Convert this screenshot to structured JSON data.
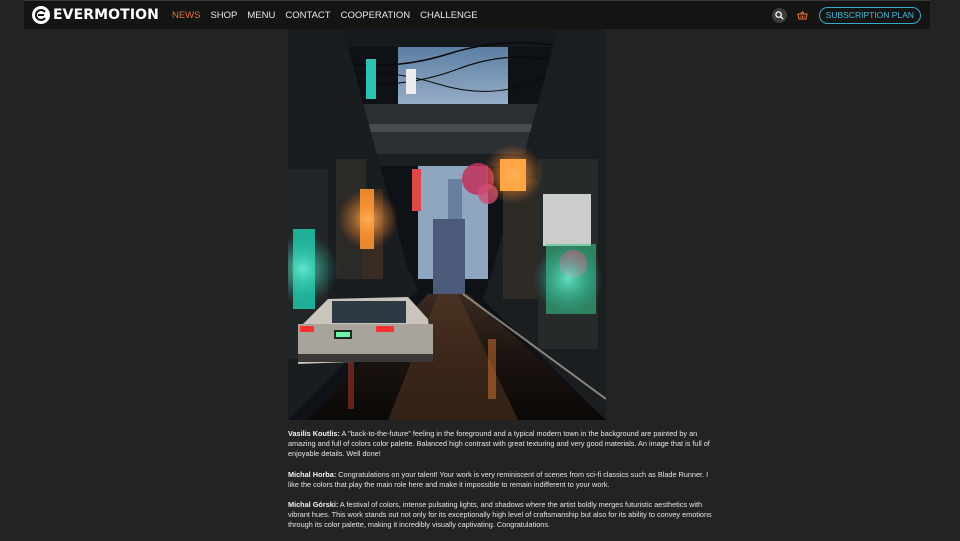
{
  "brand": {
    "name": "EVERMOTION"
  },
  "nav": {
    "items": [
      {
        "label": "NEWS",
        "active": true
      },
      {
        "label": "SHOP"
      },
      {
        "label": "MENU"
      },
      {
        "label": "CONTACT"
      },
      {
        "label": "COOPERATION"
      },
      {
        "label": "CHALLENGE"
      }
    ],
    "search_icon": "search-icon",
    "cart_icon": "basket-icon",
    "subscription_label": "SUBSCRIPTION PLAN"
  },
  "colors": {
    "accent": "#e8703a",
    "link": "#4bbbd9",
    "background": "#232323",
    "navbar": "#141414"
  },
  "hero_image": {
    "subject": "cyberpunk-neon-alley-render"
  },
  "comments": [
    {
      "author": "Vasilis Koutlis:",
      "text": " A \"back-to-the-future\" feeling in the foreground and a typical modern town in the background are painted by an amazing and full of colors color palette. Balanced high contrast with great texturing and very good materials. An image that is full of enjoyable details. Well done!"
    },
    {
      "author": "Michal Horba:",
      "text": " Congratulations on your talent! Your work is very reminiscent of scenes from sci-fi classics such as Blade Runner. I like the colors that play the main role here and make it impossible to remain indifferent to your work."
    },
    {
      "author": "Michal Górski:",
      "text": " A festival of colors, intense pulsating lights, and shadows where the artist boldly merges futuristic aesthetics with vibrant hues. This work stands out not only for its exceptionally high level of craftsmanship but also for its ability to convey emotions through its color palette, making it incredibly visually captivating. Congratulations."
    }
  ]
}
